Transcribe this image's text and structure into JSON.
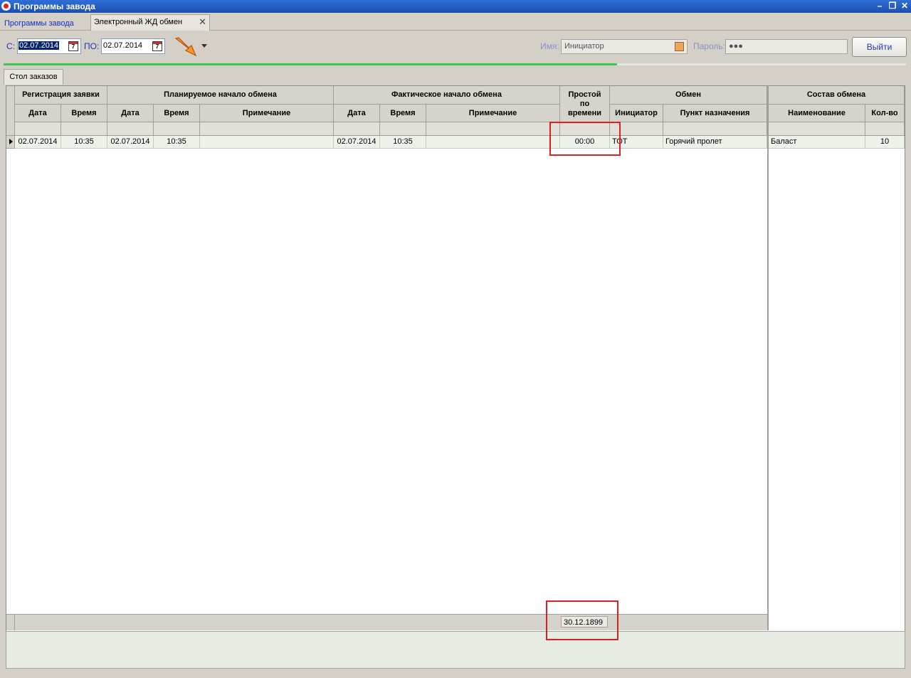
{
  "window": {
    "title": "Программы завода"
  },
  "tabs": [
    {
      "label": "Программы завода"
    },
    {
      "label": "Электронный ЖД обмен"
    }
  ],
  "filter": {
    "from_label": "С:",
    "from_value": "02.07.2014",
    "to_label": "ПО:",
    "to_value": "02.07.2014",
    "name_label": "Имя:",
    "name_value": "Инициатор",
    "password_label": "Пароль:",
    "password_value": "●●●",
    "exit_label": "Выйти",
    "progress": 0.68
  },
  "subtab": {
    "label": "Стол заказов"
  },
  "grid": {
    "groups": {
      "registration": "Регистрация заявки",
      "planned": "Планируемое начало обмена",
      "actual": "Фактическое начало обмена",
      "idle": "Простой по времени",
      "exchange": "Обмен",
      "composition": "Состав обмена"
    },
    "columns": {
      "date": "Дата",
      "time": "Время",
      "note": "Примечание",
      "initiator": "Инициатор",
      "destination": "Пункт назначения",
      "name": "Наименование",
      "qty": "Кол-во"
    },
    "row": {
      "reg_date": "02.07.2014",
      "reg_time": "10:35",
      "plan_date": "02.07.2014",
      "plan_time": "10:35",
      "plan_note": "",
      "fact_date": "02.07.2014",
      "fact_time": "10:35",
      "fact_note": "",
      "idle": "00:00",
      "initiator": "ТОТ",
      "destination": "Горячий пролет"
    },
    "composition_row": {
      "name": "Баласт",
      "qty": "10"
    },
    "footer_total": "30.12.1899"
  }
}
